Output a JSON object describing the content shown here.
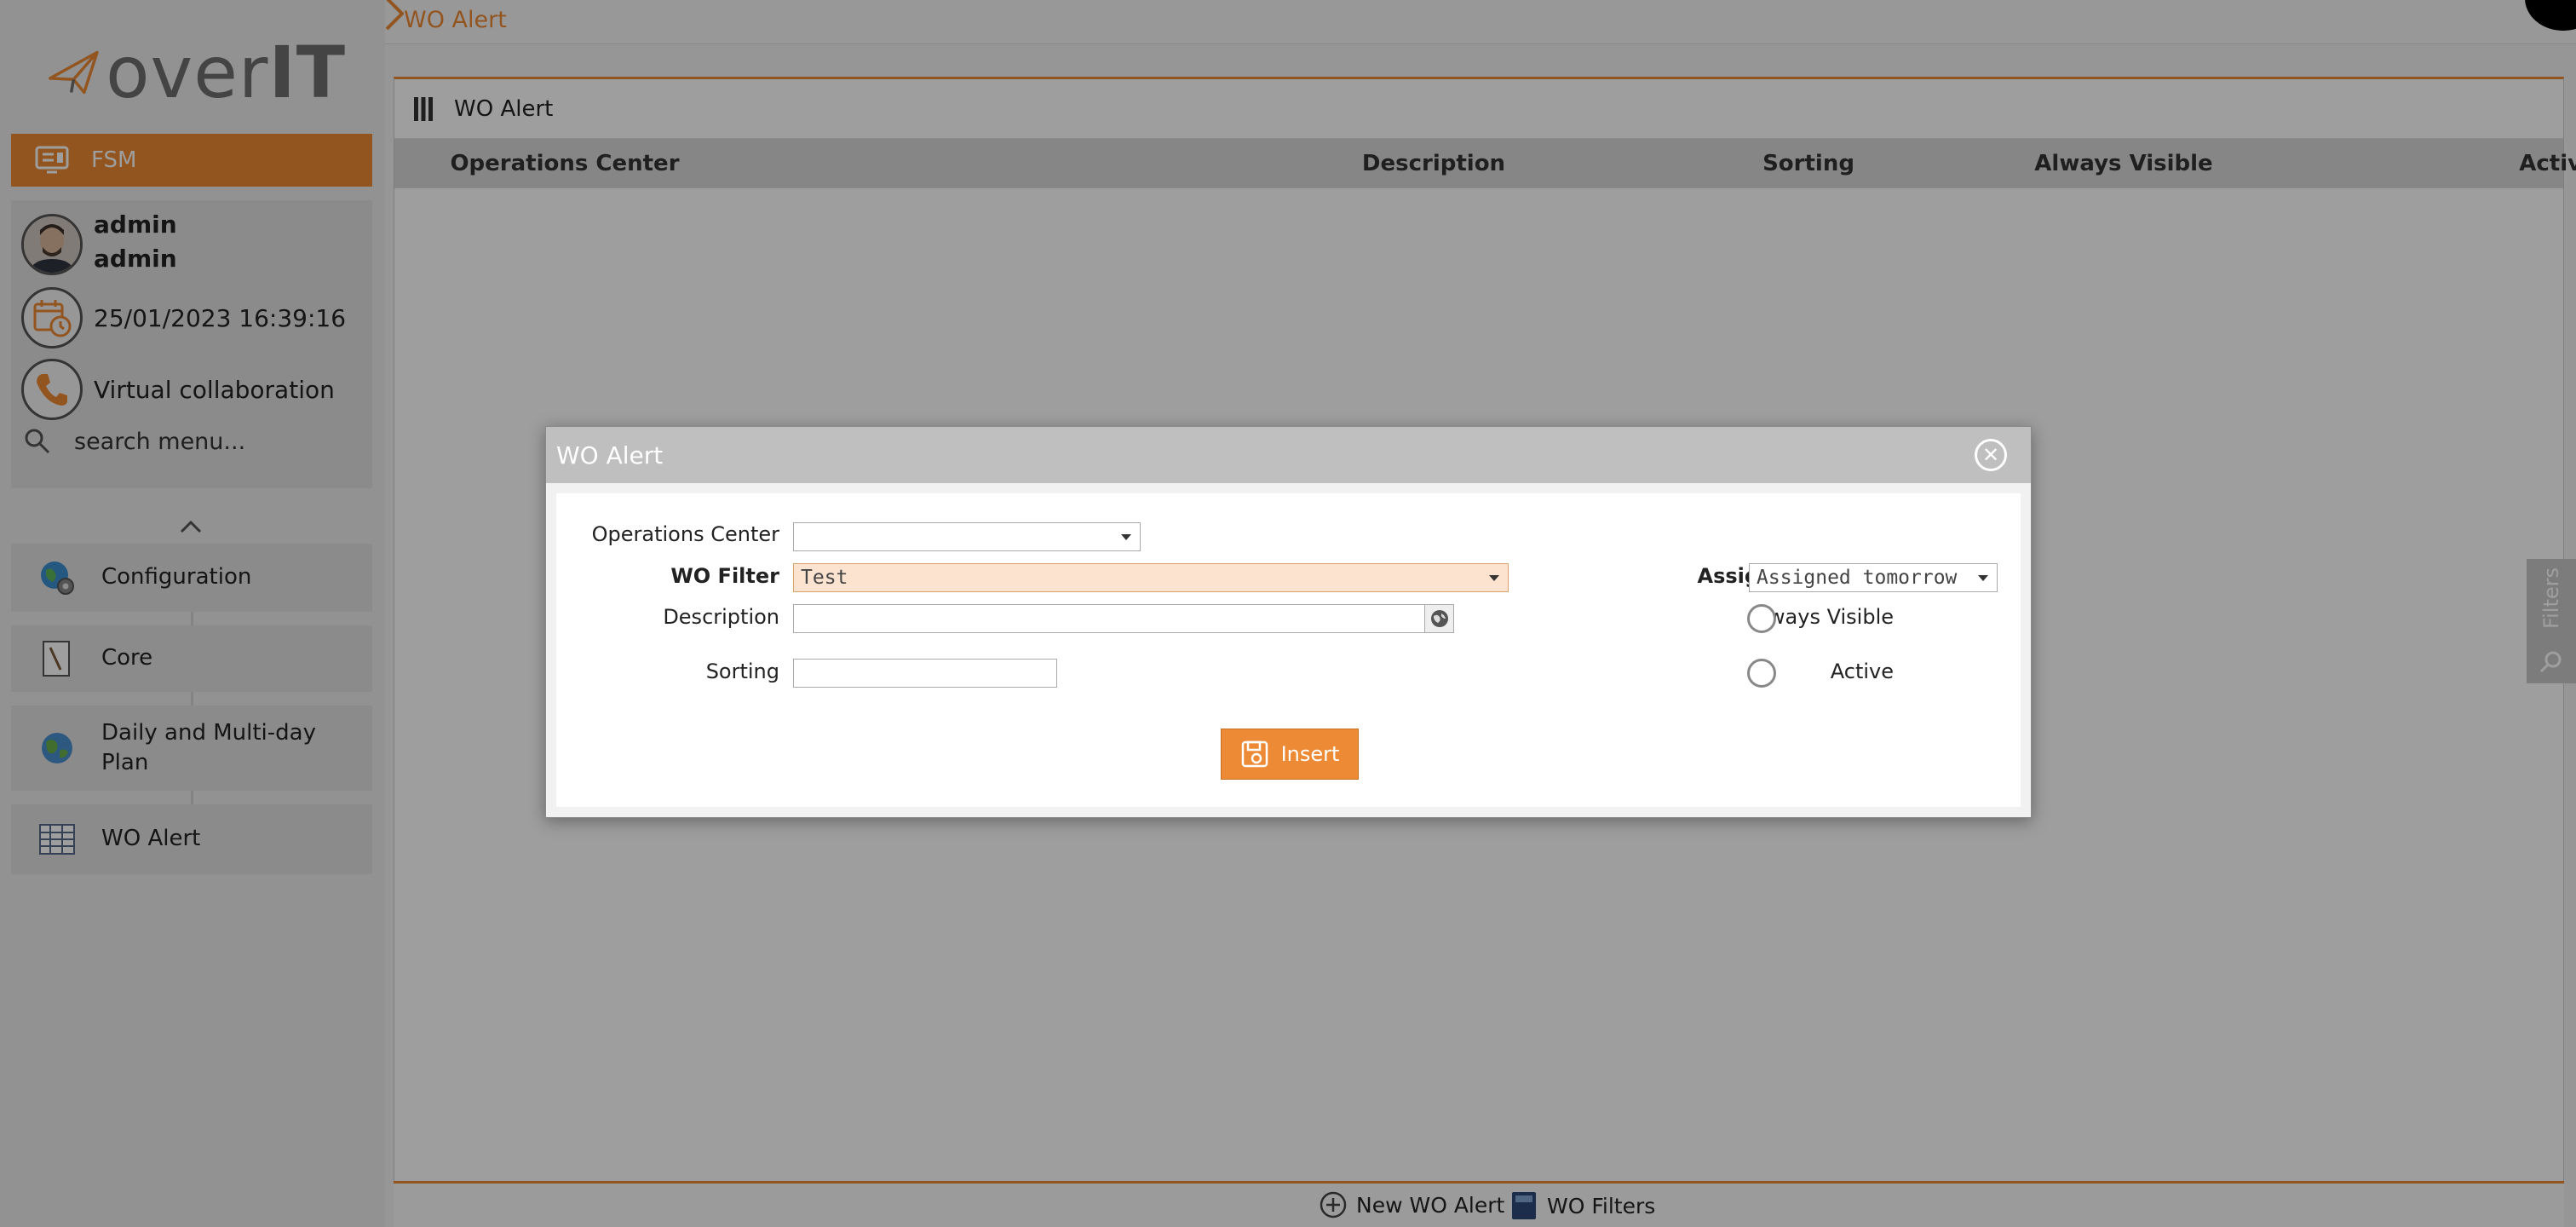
{
  "brand": {
    "logo_text_over": "over",
    "logo_text_it": "IT",
    "accent_color": "#ed8a35"
  },
  "top": {
    "tab_title": "WO Alert"
  },
  "sidebar": {
    "module": "FSM",
    "user_line1": "admin",
    "user_line2": "admin",
    "datetime": "25/01/2023 16:39:16",
    "collaboration": "Virtual collaboration",
    "search_placeholder": "search menu...",
    "items": [
      {
        "label": "Configuration",
        "icon": "globe-gear-icon"
      },
      {
        "label": "Core",
        "icon": "document-pen-icon"
      },
      {
        "label": "Daily and Multi-day Plan",
        "icon": "earth-icon"
      },
      {
        "label": "WO Alert",
        "icon": "grid-table-icon"
      }
    ]
  },
  "grid": {
    "title": "WO Alert",
    "columns": [
      "Operations Center",
      "Description",
      "Sorting",
      "Always Visible",
      "Active"
    ]
  },
  "bottom": {
    "new_label": "New WO Alert",
    "filters_label": "WO Filters"
  },
  "filters_tab": {
    "label": "Filters"
  },
  "dialog": {
    "title": "WO Alert",
    "fields": {
      "operations_center_label": "Operations Center",
      "operations_center_value": "",
      "wo_filter_label": "WO Filter",
      "wo_filter_value": "Test",
      "description_label": "Description",
      "description_value": "",
      "sorting_label": "Sorting",
      "sorting_value": "",
      "assignment_type_label": "Assignment Type",
      "assignment_type_value": "Assigned tomorrow",
      "always_visible_label": "Always Visible",
      "active_label": "Active"
    },
    "insert_label": "Insert"
  }
}
